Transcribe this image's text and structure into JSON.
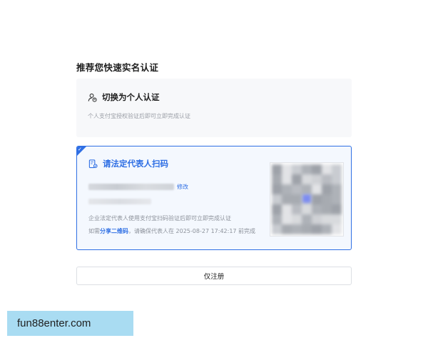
{
  "page": {
    "heading": "推荐您快速实名认证"
  },
  "personal_card": {
    "icon": "person-switch-icon",
    "title": "切换为个人认证",
    "description": "个人支付宝授权验证后即可立即完成认证"
  },
  "legal_card": {
    "icon": "scan-code-icon",
    "title": "请法定代表人扫码",
    "edit_label": "修改",
    "description": "企业法定代表人使用支付宝扫码验证后即可立即完成认证",
    "note_prefix": "如需",
    "share_label": "分享二维码",
    "note_suffix": "，请确保代表人在 2025-08-27 17:42:17 前完成",
    "accent_color": "#2f6fe4"
  },
  "register_button": {
    "label": "仅注册"
  },
  "watermark": {
    "text": "fun88enter.com"
  }
}
